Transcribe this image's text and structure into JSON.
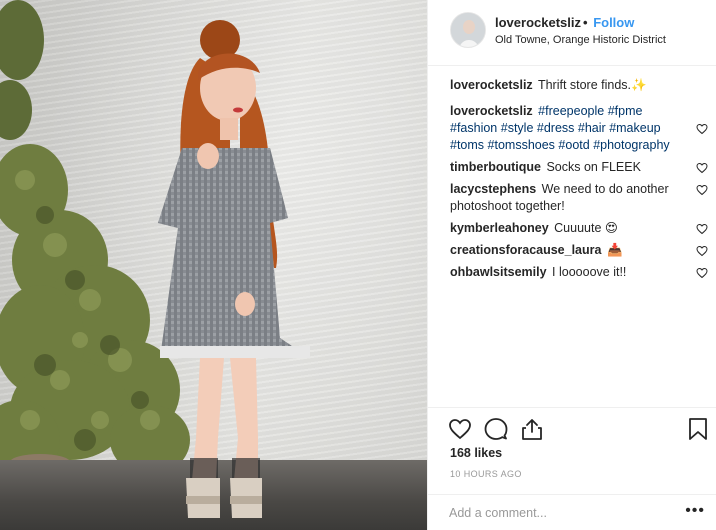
{
  "post": {
    "username": "loverocketsliz",
    "follow_label": "Follow",
    "separator": "•",
    "location": "Old Towne, Orange Historic District",
    "caption": {
      "username": "loverocketsliz",
      "text": "Thrift store finds.",
      "emoji": "✨"
    }
  },
  "comments": [
    {
      "username": "loverocketsliz",
      "hashtags": [
        "#freepeople",
        "#fpme",
        "#fashion",
        "#style",
        "#dress",
        "#hair",
        "#makeup",
        "#toms",
        "#tomsshoes",
        "#ootd",
        "#photography"
      ]
    },
    {
      "username": "timberboutique",
      "text": "Socks on FLEEK"
    },
    {
      "username": "lacycstephens",
      "text": "We need to do another photoshoot together!"
    },
    {
      "username": "kymberleahoney",
      "text": "Cuuuute 😍"
    },
    {
      "username": "creationsforacause_laura",
      "text": "📥"
    },
    {
      "username": "ohbawlsitsemily",
      "text": "I looooove it!!"
    }
  ],
  "engagement": {
    "likes": "168 likes",
    "time": "10 HOURS AGO"
  },
  "comment_box": {
    "placeholder": "Add a comment...",
    "more": "•••"
  },
  "icons": {
    "like": "heart-icon",
    "comment": "speech-bubble-icon",
    "share": "share-icon",
    "save": "bookmark-icon",
    "comment_like": "small-heart-icon"
  },
  "colors": {
    "follow": "#3897f0",
    "hashtag": "#003569",
    "muted": "#999999",
    "text": "#262626",
    "divider": "#efefef"
  }
}
